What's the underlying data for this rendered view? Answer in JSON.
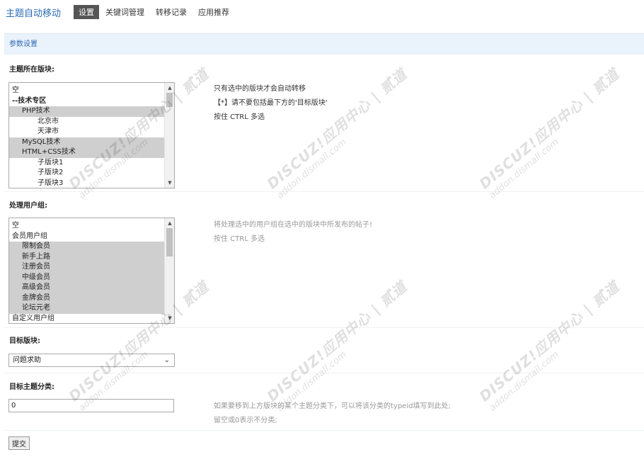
{
  "header": {
    "app_title": "主题自动移动",
    "tabs": [
      {
        "label": "设置",
        "active": true
      },
      {
        "label": "关键词管理",
        "active": false
      },
      {
        "label": "转移记录",
        "active": false
      },
      {
        "label": "应用推荐",
        "active": false
      }
    ]
  },
  "section": {
    "title": "参数设置"
  },
  "forum_field": {
    "label": "主题所在版块:",
    "options": [
      {
        "text": "空",
        "selected": false,
        "indent": 0
      },
      {
        "text": "--技术专区",
        "selected": false,
        "indent": 0,
        "bold": true
      },
      {
        "text": "PHP技术",
        "selected": true,
        "indent": 1
      },
      {
        "text": "北京市",
        "selected": false,
        "indent": 2
      },
      {
        "text": "天津市",
        "selected": false,
        "indent": 2
      },
      {
        "text": "MySQL技术",
        "selected": true,
        "indent": 1
      },
      {
        "text": "HTML+CSS技术",
        "selected": true,
        "indent": 1
      },
      {
        "text": "子版块1",
        "selected": false,
        "indent": 2
      },
      {
        "text": "子版块2",
        "selected": false,
        "indent": 2
      },
      {
        "text": "子版块3",
        "selected": false,
        "indent": 2
      }
    ],
    "help": [
      "只有选中的版块才会自动转移",
      "【*】请不要包括最下方的'目标版块'",
      "按住 CTRL 多选"
    ]
  },
  "usergroup_field": {
    "label": "处理用户组:",
    "options": [
      {
        "text": "空",
        "selected": false,
        "indent": 0
      },
      {
        "text": "会员用户组",
        "selected": false,
        "indent": 0
      },
      {
        "text": "限制会员",
        "selected": true,
        "indent": 1
      },
      {
        "text": "新手上路",
        "selected": true,
        "indent": 1
      },
      {
        "text": "注册会员",
        "selected": true,
        "indent": 1
      },
      {
        "text": "中级会员",
        "selected": true,
        "indent": 1
      },
      {
        "text": "高级会员",
        "selected": true,
        "indent": 1
      },
      {
        "text": "金牌会员",
        "selected": true,
        "indent": 1
      },
      {
        "text": "论坛元老",
        "selected": true,
        "indent": 1
      },
      {
        "text": "自定义用户组",
        "selected": false,
        "indent": 0
      }
    ],
    "help": [
      "将处理选中的用户组在选中的版块中所发布的帖子!",
      "按住 CTRL 多选"
    ]
  },
  "target_forum_field": {
    "label": "目标版块:",
    "value": "问题求助"
  },
  "target_type_field": {
    "label": "目标主题分类:",
    "value": "0",
    "help": [
      "如果要移到上方版块的某个主题分类下，可以将该分类的typeid填写到此处;",
      "留空或0表示不分类;"
    ]
  },
  "submit_label": "提交",
  "watermark": {
    "line1": "DISCUZ!应用中心 | 贰道",
    "line2": "addon.dismall.com"
  }
}
